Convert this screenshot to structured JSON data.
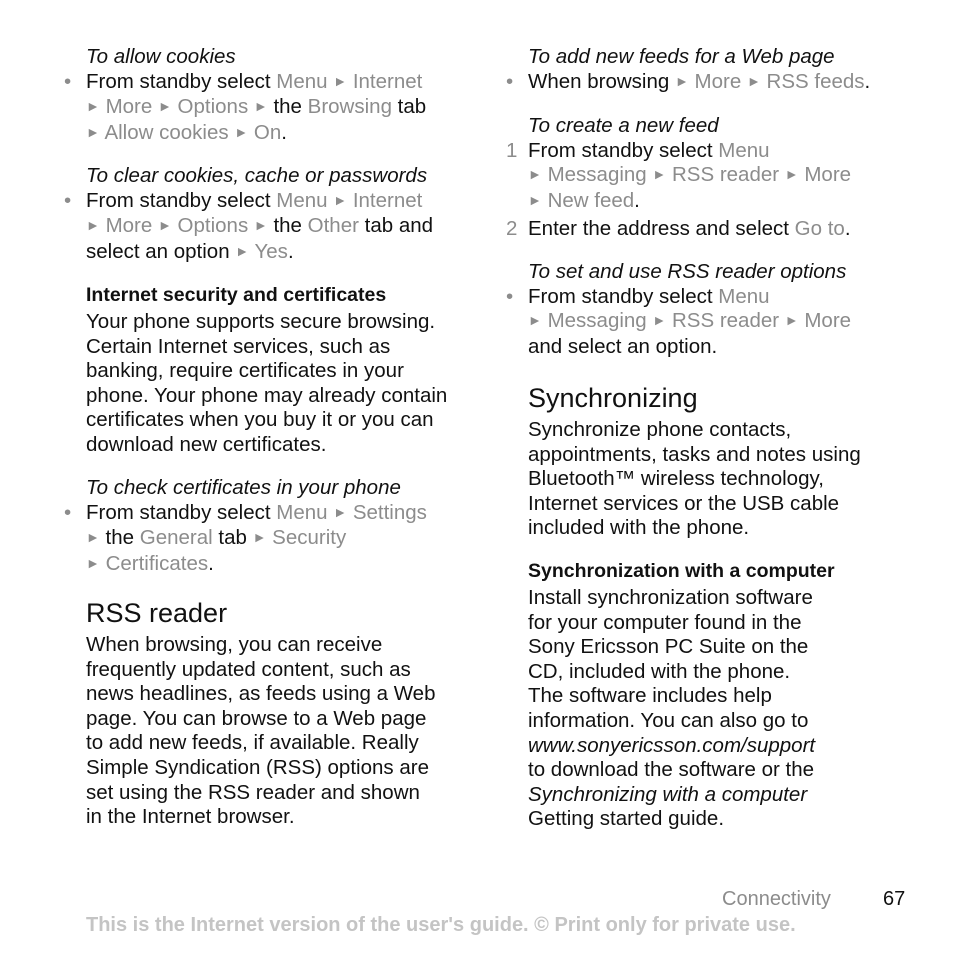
{
  "arrow_glyph": "►",
  "bullet_glyph": "•",
  "left": {
    "allow_cookies": {
      "title": "To allow cookies",
      "l1": {
        "t1": "From standby select ",
        "g1": "Menu",
        "g2": "Internet"
      },
      "l2": {
        "g1": "More",
        "g2": "Options",
        "t1": " the ",
        "g3": "Browsing",
        "t2": " tab"
      },
      "l3": {
        "g1": "Allow cookies",
        "g2": "On",
        "t1": "."
      }
    },
    "clear_cookies": {
      "title": "To clear cookies, cache or passwords",
      "l1": {
        "t1": "From standby select ",
        "g1": "Menu",
        "g2": "Internet"
      },
      "l2": {
        "g1": "More",
        "g2": "Options",
        "t1": " the ",
        "g3": "Other",
        "t2": " tab and"
      },
      "l3": {
        "t1": "select an option ",
        "g1": "Yes",
        "t2": "."
      }
    },
    "security": {
      "heading": "Internet security and certificates",
      "lines": [
        "Your phone supports secure browsing.",
        "Certain Internet services, such as",
        "banking, require certificates in your",
        "phone. Your phone may already contain",
        "certificates when you buy it or you can",
        "download new certificates."
      ]
    },
    "check_certs": {
      "title": "To check certificates in your phone",
      "l1": {
        "t1": "From standby select ",
        "g1": "Menu",
        "g2": "Settings"
      },
      "l2": {
        "t1": " the ",
        "g1": "General",
        "t2": " tab ",
        "g2": "Security"
      },
      "l3": {
        "g1": "Certificates",
        "t1": "."
      }
    },
    "rss": {
      "heading": "RSS reader",
      "lines": [
        "When browsing, you can receive",
        "frequently updated content, such as",
        "news headlines, as feeds using a Web",
        "page. You can browse to a Web page",
        "to add new feeds, if available. Really",
        "Simple Syndication (RSS) options are",
        "set using the RSS reader and shown",
        "in the Internet browser."
      ]
    }
  },
  "right": {
    "add_feeds": {
      "title": "To add new feeds for a Web page",
      "l1": {
        "t1": "When browsing ",
        "g1": "More",
        "g2": "RSS feeds",
        "t2": "."
      }
    },
    "create_feed": {
      "title": "To create a new feed",
      "step1_num": "1",
      "s1l1": {
        "t1": "From standby select ",
        "g1": "Menu"
      },
      "s1l2": {
        "g1": "Messaging",
        "g2": "RSS reader",
        "g3": "More"
      },
      "s1l3": {
        "g1": "New feed",
        "t1": "."
      },
      "step2_num": "2",
      "s2l1": {
        "t1": "Enter the address and select ",
        "g1": "Go to",
        "t2": "."
      }
    },
    "rss_options": {
      "title": "To set and use RSS reader options",
      "l1": {
        "t1": "From standby select ",
        "g1": "Menu"
      },
      "l2": {
        "g1": "Messaging",
        "g2": "RSS reader",
        "g3": "More"
      },
      "l3": {
        "t1": "and select an option."
      }
    },
    "sync": {
      "heading": "Synchronizing",
      "lines": [
        "Synchronize phone contacts,",
        "appointments, tasks and notes using",
        "Bluetooth™ wireless technology,",
        "Internet services or the USB cable",
        "included with the phone."
      ]
    },
    "sync_computer": {
      "heading": "Synchronization with a computer",
      "lines": [
        "Install synchronization software",
        "for your computer found in the",
        "Sony Ericsson PC Suite on the",
        "CD, included with the phone.",
        "The software includes help",
        "information. You can also go to"
      ],
      "link": "www.sonyericsson.com/support",
      "line_after_link": "to download the software or the",
      "guide_title": "Synchronizing with a computer",
      "last_line": "Getting started guide."
    }
  },
  "footer": {
    "section": "Connectivity",
    "page_number": "67",
    "note": "This is the Internet version of the user's guide. © Print only for private use."
  }
}
